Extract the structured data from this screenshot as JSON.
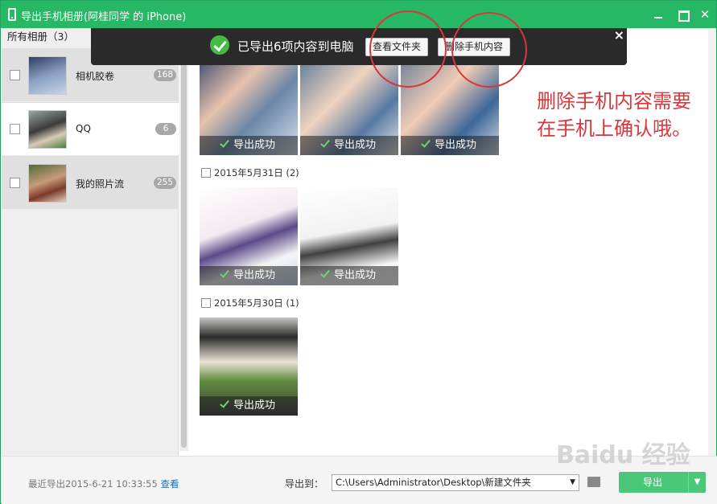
{
  "window": {
    "title": "导出手机相册(阿桂同学 的 iPhone)",
    "close_glyph": "✕"
  },
  "sidebar": {
    "header": "所有相册（3）",
    "albums": [
      {
        "name": "相机胶卷",
        "count": "168"
      },
      {
        "name": "QQ",
        "count": "6"
      },
      {
        "name": "我的照片流",
        "count": "255"
      }
    ]
  },
  "toast": {
    "message": "已导出6项内容到电脑",
    "view_folder": "查看文件夹",
    "delete_phone": "删除手机内容",
    "close_glyph": "×"
  },
  "groups": [
    {
      "label": "",
      "photos": [
        "导出成功",
        "导出成功",
        "导出成功"
      ]
    },
    {
      "label": "2015年5月31日 (2)",
      "photos": [
        "导出成功",
        "导出成功"
      ]
    },
    {
      "label": "2015年5月30日 (1)",
      "photos": [
        "导出成功"
      ]
    }
  ],
  "annotation": "删除手机内容需要在手机上确认哦。",
  "footer": {
    "last_export": "最近导出2015-6-21 10:33:55",
    "view_link": "查看",
    "export_to_label": "导出到：",
    "path": "C:\\Users\\Administrator\\Desktop\\新建文件夹",
    "export_button": "导出"
  },
  "icons": {
    "phone": "phone-icon",
    "check": "check-icon",
    "folder": "folder-icon",
    "dropdown": "▼"
  },
  "colors": {
    "titlebar": "#26b865",
    "toast_bg": "#2a2a2a",
    "annotation": "#d8373b",
    "export_button": "#4bc77a"
  },
  "watermark": "Baidu 经验"
}
